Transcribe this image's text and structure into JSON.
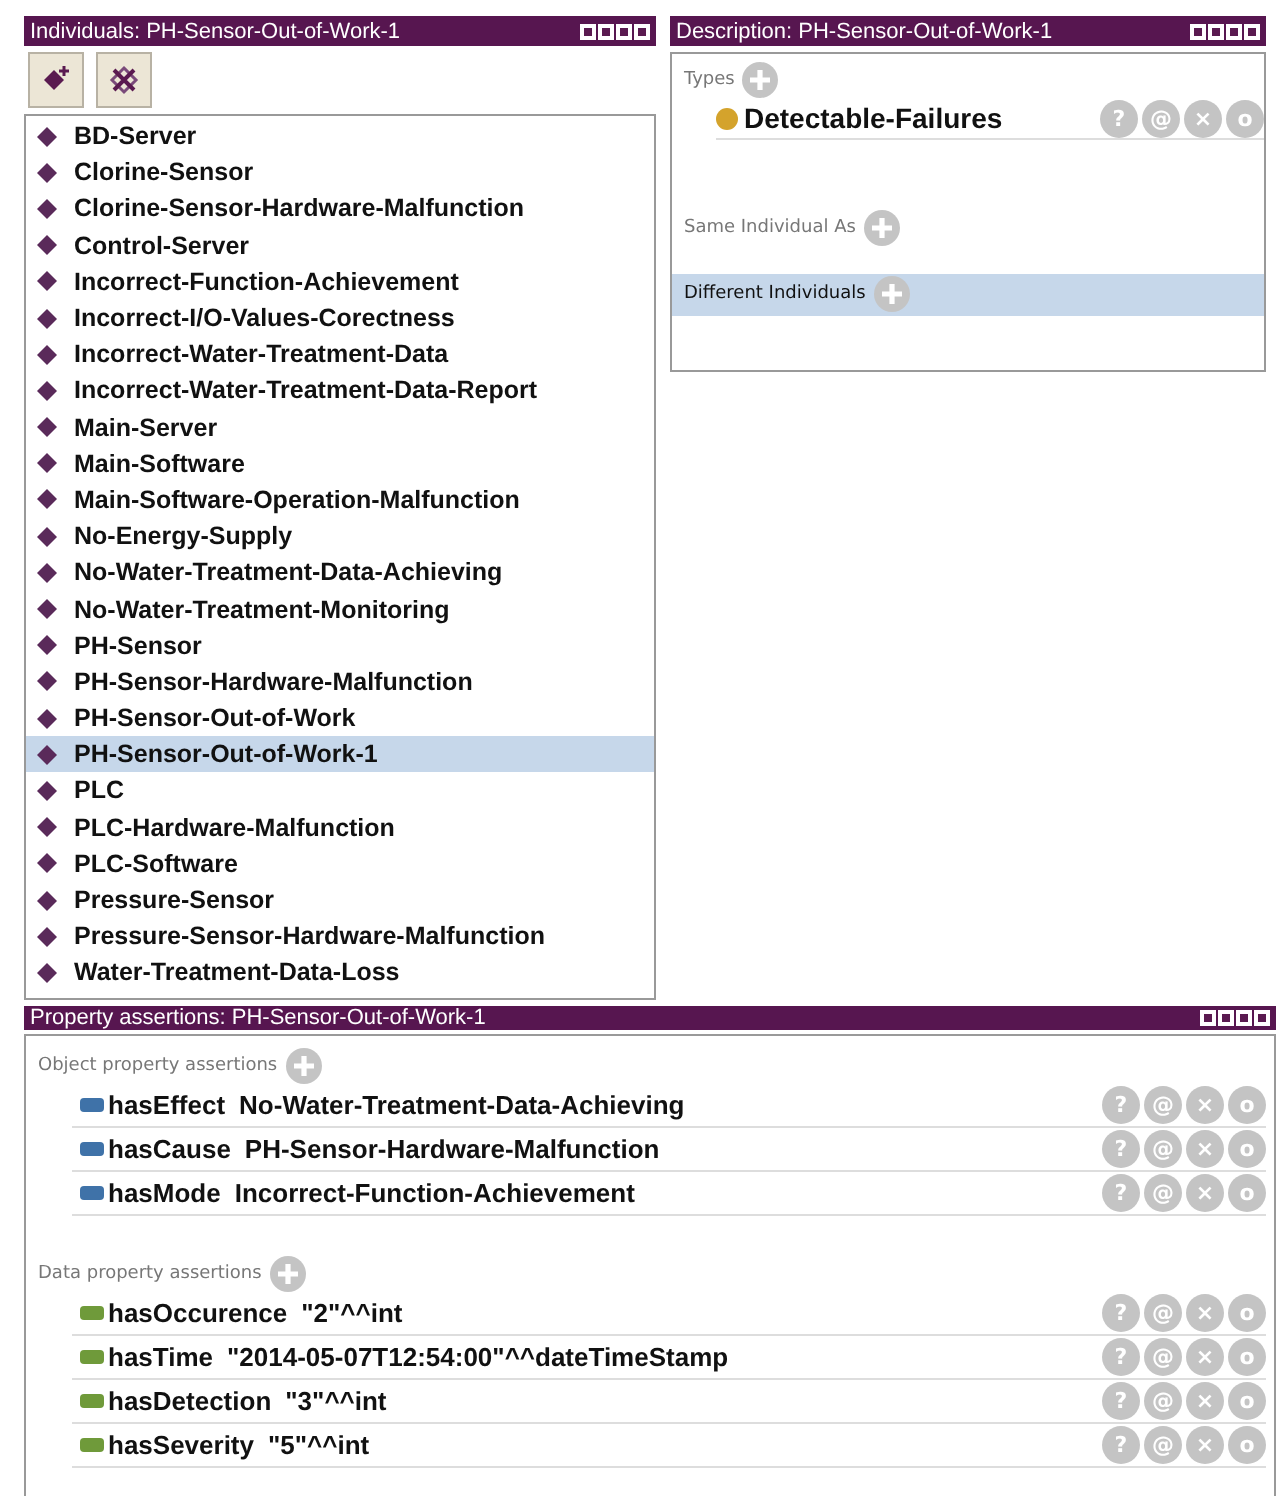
{
  "individuals_panel": {
    "title": "Individuals: PH-Sensor-Out-of-Work-1",
    "items": [
      {
        "label": "BD-Server",
        "selected": false
      },
      {
        "label": "Clorine-Sensor",
        "selected": false
      },
      {
        "label": "Clorine-Sensor-Hardware-Malfunction",
        "selected": false
      },
      {
        "label": "Control-Server",
        "selected": false
      },
      {
        "label": "Incorrect-Function-Achievement",
        "selected": false
      },
      {
        "label": "Incorrect-I/O-Values-Corectness",
        "selected": false
      },
      {
        "label": "Incorrect-Water-Treatment-Data",
        "selected": false
      },
      {
        "label": "Incorrect-Water-Treatment-Data-Report",
        "selected": false
      },
      {
        "label": "Main-Server",
        "selected": false
      },
      {
        "label": "Main-Software",
        "selected": false
      },
      {
        "label": "Main-Software-Operation-Malfunction",
        "selected": false
      },
      {
        "label": "No-Energy-Supply",
        "selected": false
      },
      {
        "label": "No-Water-Treatment-Data-Achieving",
        "selected": false
      },
      {
        "label": "No-Water-Treatment-Monitoring",
        "selected": false
      },
      {
        "label": "PH-Sensor",
        "selected": false
      },
      {
        "label": "PH-Sensor-Hardware-Malfunction",
        "selected": false
      },
      {
        "label": "PH-Sensor-Out-of-Work",
        "selected": false
      },
      {
        "label": "PH-Sensor-Out-of-Work-1",
        "selected": true
      },
      {
        "label": "PLC",
        "selected": false
      },
      {
        "label": "PLC-Hardware-Malfunction",
        "selected": false
      },
      {
        "label": "PLC-Software",
        "selected": false
      },
      {
        "label": "Pressure-Sensor",
        "selected": false
      },
      {
        "label": "Pressure-Sensor-Hardware-Malfunction",
        "selected": false
      },
      {
        "label": "Water-Treatment-Data-Loss",
        "selected": false
      }
    ]
  },
  "description_panel": {
    "title": "Description: PH-Sensor-Out-of-Work-1",
    "sections": [
      {
        "label": "Types",
        "highlighted": false,
        "items": [
          {
            "label": "Detectable-Failures",
            "actions": [
              "?",
              "@",
              "×",
              "o"
            ]
          }
        ]
      },
      {
        "label": "Same Individual As",
        "highlighted": false
      },
      {
        "label": "Different Individuals",
        "highlighted": true
      }
    ]
  },
  "property_panel": {
    "title": "Property assertions: PH-Sensor-Out-of-Work-1",
    "sections": [
      {
        "kind": "object",
        "label": "Object property assertions",
        "rows": [
          {
            "property": "hasEffect",
            "value": "No-Water-Treatment-Data-Achieving",
            "actions": [
              "?",
              "@",
              "×",
              "o"
            ]
          },
          {
            "property": "hasCause",
            "value": "PH-Sensor-Hardware-Malfunction",
            "actions": [
              "?",
              "@",
              "×",
              "o"
            ]
          },
          {
            "property": "hasMode",
            "value": "Incorrect-Function-Achievement",
            "actions": [
              "?",
              "@",
              "×",
              "o"
            ]
          }
        ]
      },
      {
        "kind": "data",
        "label": "Data property assertions",
        "rows": [
          {
            "property": "hasOccurence",
            "value": "\"2\"^^int",
            "actions": [
              "?",
              "@",
              "×",
              "o"
            ]
          },
          {
            "property": "hasTime",
            "value": "\"2014-05-07T12:54:00\"^^dateTimeStamp",
            "actions": [
              "?",
              "@",
              "×",
              "o"
            ]
          },
          {
            "property": "hasDetection",
            "value": "\"3\"^^int",
            "actions": [
              "?",
              "@",
              "×",
              "o"
            ]
          },
          {
            "property": "hasSeverity",
            "value": "\"5\"^^int",
            "actions": [
              "?",
              "@",
              "×",
              "o"
            ]
          }
        ]
      }
    ]
  }
}
